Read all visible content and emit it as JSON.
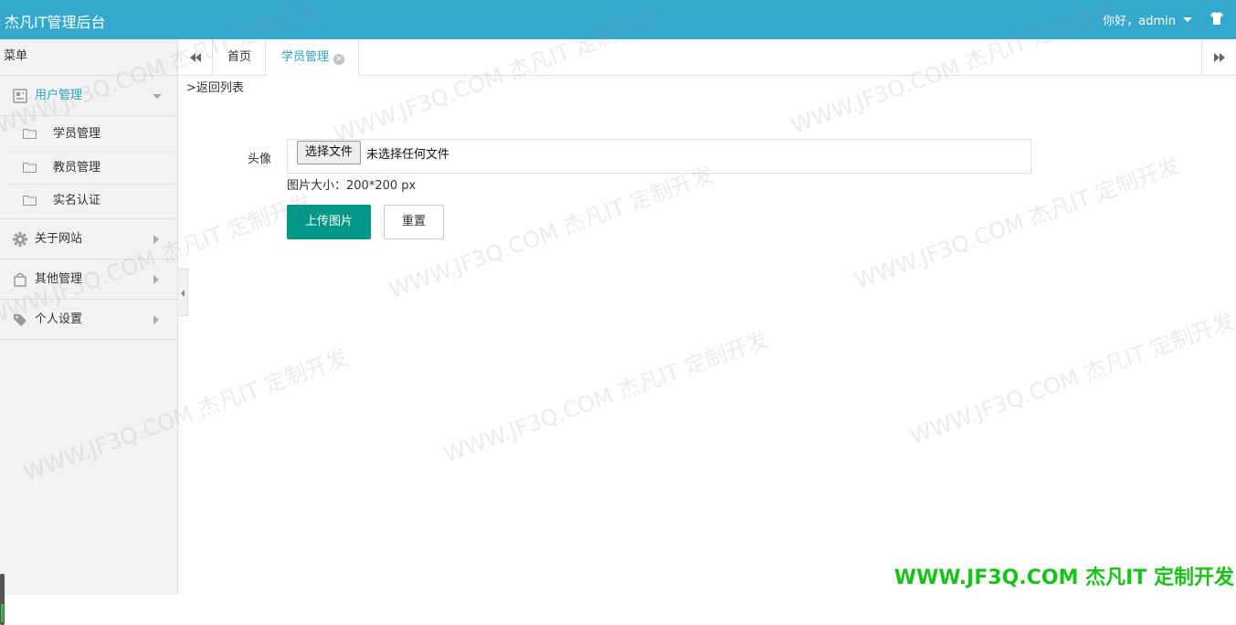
{
  "header": {
    "title": "杰凡IT管理后台",
    "user_greeting": "你好，admin",
    "icon": "shirt-icon"
  },
  "sidebar": {
    "menu_title": "菜单",
    "groups": [
      {
        "label": "用户管理",
        "icon": "user-management-icon",
        "expanded": true,
        "items": [
          {
            "label": "学员管理"
          },
          {
            "label": "教员管理"
          },
          {
            "label": "实名认证"
          }
        ]
      },
      {
        "label": "关于网站",
        "icon": "gear-icon"
      },
      {
        "label": "其他管理",
        "icon": "shopping-bag-icon"
      },
      {
        "label": "个人设置",
        "icon": "tag-icon"
      }
    ]
  },
  "tabs": {
    "items": [
      {
        "label": "首页"
      },
      {
        "label": "学员管理",
        "active": true
      }
    ]
  },
  "main": {
    "back_link": ">返回列表",
    "avatar_label": "头像",
    "file_button": "选择文件",
    "file_status": "未选择任何文件",
    "hint": "图片大小：200*200 px",
    "upload_button": "上传图片",
    "reset_button": "重置"
  },
  "watermark": {
    "text": "WWW.JF3Q.COM 杰凡IT  定制开发",
    "color": "#19c219"
  },
  "colors": {
    "header": "#35a8cf",
    "accent": "#2aa3c9",
    "primary_button": "#009688"
  }
}
